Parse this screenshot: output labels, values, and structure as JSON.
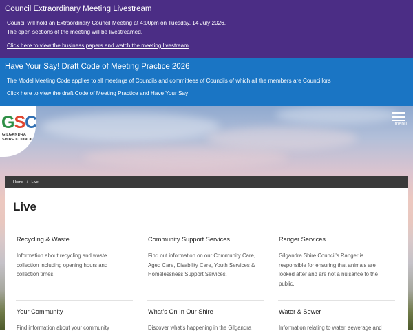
{
  "alerts": [
    {
      "title": "Council Extraordinary Meeting Livestream",
      "lines": [
        "Council will hold an Extraordinary Council Meeting at 4:00pm on Tuesday, 14 July 2026.",
        "The open sections of the meeting will be livestreamed."
      ],
      "link": "Click here to view the business papers and watch the meeting livestream"
    },
    {
      "title": "Have Your Say! Draft Code of Meeting Practice 2026",
      "lines": [
        "The Model Meeting Code applies to all meetings of Councils and committees of Councils of which all the members are Councillors"
      ],
      "link": "Click here to view the draft Code of Meeting Practice and Have Your Say"
    }
  ],
  "logo": {
    "letters": [
      "G",
      "S",
      "C"
    ],
    "name_line1": "GILGANDRA",
    "name_line2": "SHIRE COUNCIL"
  },
  "menu": {
    "label": "menu",
    "icon": "hamburger-icon"
  },
  "breadcrumb": {
    "home": "Home",
    "separator": "/",
    "current": "Live"
  },
  "page": {
    "title": "Live"
  },
  "cards": [
    {
      "title": "Recycling & Waste",
      "desc": "Information about recycling and waste collection including opening hours and collection times."
    },
    {
      "title": "Community Support Services",
      "desc": "Find out information on our Community Care, Aged Care, Disability Care, Youth Services & Homelessness Support Services."
    },
    {
      "title": "Ranger Services",
      "desc": "Gilgandra Shire Council's Ranger is responsible for ensuring that animals are looked after and are not a nuisance to the public."
    },
    {
      "title": "Your Community",
      "desc": "Find information about your community"
    },
    {
      "title": "What's On In Our Shire",
      "desc": "Discover what's happening in the Gilgandra"
    },
    {
      "title": "Water & Sewer",
      "desc": "Information relating to water, sewerage and"
    }
  ],
  "colors": {
    "alert_purple": "#4b2d85",
    "alert_blue": "#1a75c4",
    "breadcrumb_bg": "#3a3a3a"
  }
}
